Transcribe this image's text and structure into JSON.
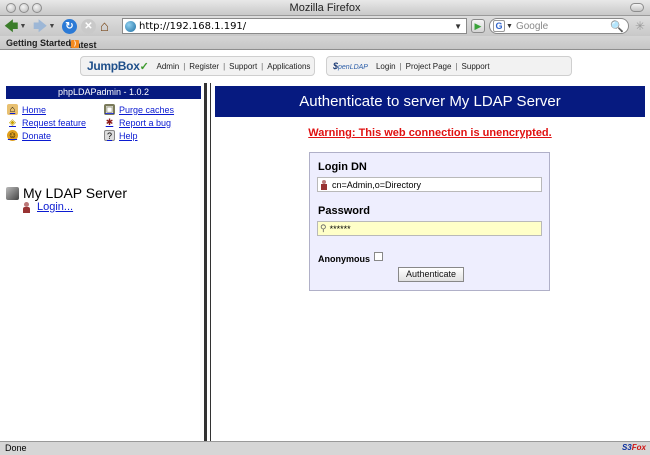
{
  "window": {
    "title": "Mozilla Firefox"
  },
  "browser": {
    "url": "http://192.168.1.191/",
    "search_placeholder": "Google",
    "bookmarks": [
      "Getting Started",
      "Latest Headlines"
    ]
  },
  "jumpbox": {
    "logo": "JumpBox",
    "links": [
      "Admin",
      "Register",
      "Support",
      "Applications"
    ]
  },
  "openldap": {
    "logo": "penLDAP",
    "links": [
      "Login",
      "Project Page",
      "Support"
    ]
  },
  "sidebar": {
    "header": "phpLDAPadmin - 1.0.2",
    "links": {
      "home": "Home",
      "purge": "Purge caches",
      "request": "Request feature",
      "report": "Report a bug",
      "donate": "Donate",
      "help": "Help"
    },
    "server_name": "My LDAP Server",
    "login_link": "Login..."
  },
  "main": {
    "header": "Authenticate to server My LDAP Server",
    "warning": "Warning: This web connection is unencrypted.",
    "login_dn_label": "Login DN",
    "login_dn_value": "cn=Admin,o=Directory",
    "password_label": "Password",
    "password_value": "******",
    "anonymous_label": "Anonymous",
    "authenticate_button": "Authenticate"
  },
  "status": {
    "text": "Done",
    "addon": "S3Fox"
  },
  "colors": {
    "header_bg": "#061a80",
    "warning": "#e01111",
    "link": "#0b1bd1",
    "form_bg": "#eeeefe",
    "password_bg": "#ffffc8"
  }
}
